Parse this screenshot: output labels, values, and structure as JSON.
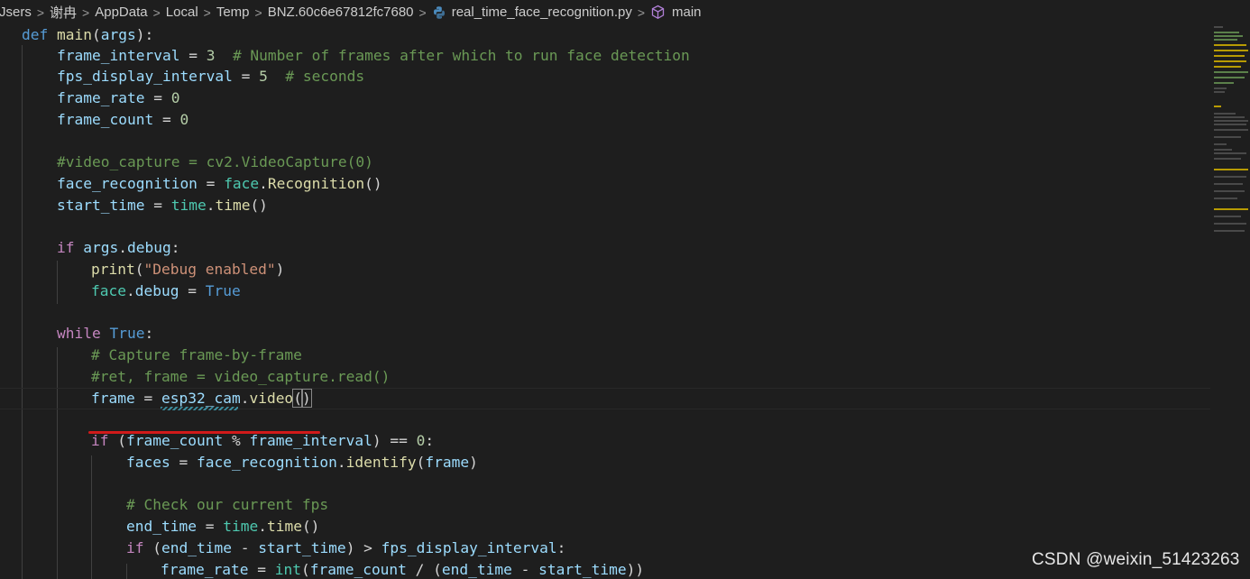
{
  "breadcrumb": {
    "items": [
      "Jsers",
      "谢冉",
      "AppData",
      "Local",
      "Temp",
      "BNZ.60c6e67812fc7680"
    ],
    "file": "real_time_face_recognition.py",
    "symbol": "main",
    "file_icon": "python-icon",
    "symbol_icon": "cube-symbol-icon"
  },
  "code": [
    "def main(args):",
    "    frame_interval = 3  # Number of frames after which to run face detection",
    "    fps_display_interval = 5  # seconds",
    "    frame_rate = 0",
    "    frame_count = 0",
    "",
    "    #video_capture = cv2.VideoCapture(0)",
    "    face_recognition = face.Recognition()",
    "    start_time = time.time()",
    "",
    "    if args.debug:",
    "        print(\"Debug enabled\")",
    "        face.debug = True",
    "",
    "    while True:",
    "        # Capture frame-by-frame",
    "        #ret, frame = video_capture.read()",
    "        frame = esp32_cam.video()",
    "",
    "        if (frame_count % frame_interval) == 0:",
    "            faces = face_recognition.identify(frame)",
    "",
    "            # Check our current fps",
    "            end_time = time.time()",
    "            if (end_time - start_time) > fps_display_interval:",
    "                frame_rate = int(frame_count / (end_time - start_time))"
  ],
  "tokens": {
    "l0": [
      "def",
      "main",
      "(",
      "args",
      "):"
    ],
    "l1": [
      "frame_interval",
      " = ",
      "3",
      "  # Number of frames after which to run face detection"
    ],
    "l2": [
      "fps_display_interval",
      " = ",
      "5",
      "  # seconds"
    ],
    "l3": [
      "frame_rate",
      " = ",
      "0"
    ],
    "l4": [
      "frame_count",
      " = ",
      "0"
    ],
    "l6": [
      "#video_capture = cv2.VideoCapture(0)"
    ],
    "l7": [
      "face_recognition",
      " = ",
      "face",
      ".",
      "Recognition",
      "()"
    ],
    "l8": [
      "start_time",
      " = ",
      "time",
      ".",
      "time",
      "()"
    ],
    "l10": [
      "if",
      " ",
      "args",
      ".",
      "debug",
      ":"
    ],
    "l11": [
      "print",
      "(",
      "\"Debug enabled\"",
      ")"
    ],
    "l12": [
      "face",
      ".",
      "debug",
      " = ",
      "True"
    ],
    "l14": [
      "while",
      " ",
      "True",
      ":"
    ],
    "l15": [
      "# Capture frame-by-frame"
    ],
    "l16": [
      "#ret, frame = video_capture.read()"
    ],
    "l17": [
      "frame",
      " = ",
      "esp32_cam",
      ".",
      "video",
      "(",
      ")"
    ],
    "l19": [
      "if",
      " (",
      "frame_count",
      " % ",
      "frame_interval",
      ") == ",
      "0",
      ":"
    ],
    "l20": [
      "faces",
      " = ",
      "face_recognition",
      ".",
      "identify",
      "(",
      "frame",
      ")"
    ],
    "l22": [
      "# Check our current fps"
    ],
    "l23": [
      "end_time",
      " = ",
      "time",
      ".",
      "time",
      "()"
    ],
    "l24": [
      "if",
      " (",
      "end_time",
      " - ",
      "start_time",
      ") > ",
      "fps_display_interval",
      ":"
    ],
    "l25": [
      "frame_rate",
      " = ",
      "int",
      "(",
      "frame_count",
      " / (",
      "end_time",
      " - ",
      "start_time",
      "))"
    ]
  },
  "annotation": {
    "underline_color": "#d11a1a",
    "marks": "frame = esp32_cam.video()"
  },
  "theme": {
    "background": "#1e1e1e",
    "keyword": "#569cd6",
    "control": "#c586c0",
    "function": "#dcdcaa",
    "variable": "#9cdcfe",
    "number": "#b5cea8",
    "string": "#ce9178",
    "comment": "#6a9955",
    "module": "#4ec9b0"
  },
  "watermark": "CSDN @weixin_51423263"
}
